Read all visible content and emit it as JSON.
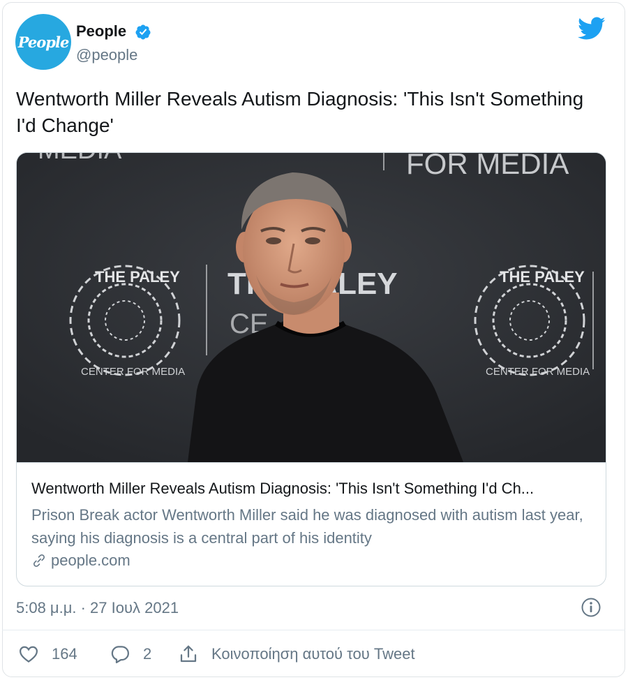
{
  "author": {
    "avatar_text": "People",
    "name": "People",
    "handle": "@people",
    "verified": true
  },
  "tweet": {
    "text": "Wentworth Miller Reveals Autism Diagnosis: 'This Isn't Something I'd Change'"
  },
  "link_card": {
    "title": "Wentworth Miller Reveals Autism Diagnosis: 'This Isn't Something I'd Ch...",
    "description": "Prison Break actor Wentworth Miller said he was diagnosed with autism last year, saying his diagnosis is a central part of his identity",
    "domain": "people.com",
    "image_backdrop_text": {
      "top_right": "FOR MEDIA",
      "top_left": "MEDIA",
      "center": "THE PALEY",
      "center_line2": "CE",
      "seal_top": "THE PALEY",
      "seal_ring": "CENTER FOR MEDIA"
    }
  },
  "timestamp": "5:08 μ.μ. · 27 Ιουλ 2021",
  "actions": {
    "likes": "164",
    "replies": "2",
    "share_label": "Κοινοποίηση αυτού του Tweet"
  },
  "colors": {
    "brand_blue": "#1da1f2",
    "avatar_bg": "#27a8e0",
    "secondary_text": "#657786",
    "primary_text": "#14171a"
  },
  "icons": [
    "verified-badge-icon",
    "twitter-bird-icon",
    "link-icon",
    "info-icon",
    "heart-icon",
    "reply-bubble-icon",
    "share-icon"
  ]
}
